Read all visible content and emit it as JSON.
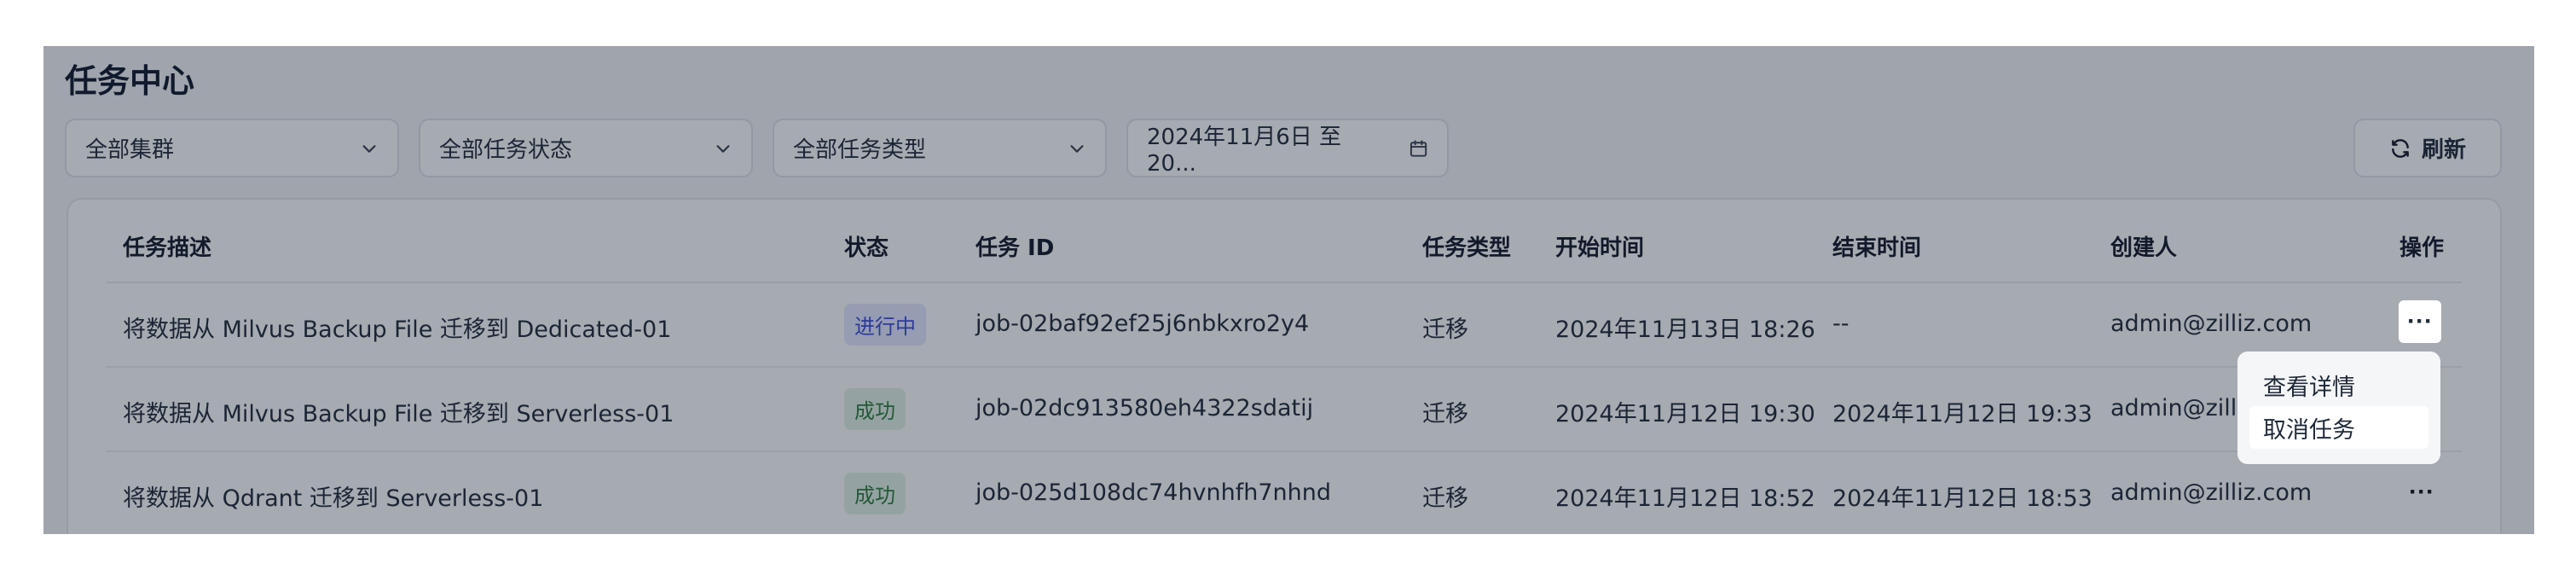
{
  "page": {
    "title": "任务中心"
  },
  "filters": {
    "cluster": "全部集群",
    "status": "全部任务状态",
    "type": "全部任务类型",
    "date_range": "2024年11月6日 至 20..."
  },
  "refresh_label": "刷新",
  "table": {
    "headers": {
      "desc": "任务描述",
      "status": "状态",
      "id": "任务 ID",
      "type": "任务类型",
      "start": "开始时间",
      "end": "结束时间",
      "creator": "创建人",
      "actions": "操作"
    },
    "rows": [
      {
        "desc": "将数据从 Milvus Backup File 迁移到 Dedicated-01",
        "status": "进行中",
        "id": "job-02baf92ef25j6nbkxro2y4",
        "type": "迁移",
        "start": "2024年11月13日 18:26",
        "end": "--",
        "creator": "admin@zilliz.com",
        "actions": "···"
      },
      {
        "desc": "将数据从 Milvus Backup File 迁移到 Serverless-01",
        "status": "成功",
        "id": "job-02dc913580eh4322sdatij",
        "type": "迁移",
        "start": "2024年11月12日 19:30",
        "end": "2024年11月12日 19:33",
        "creator": "admin@zilliz.com",
        "actions": "···"
      },
      {
        "desc": "将数据从 Qdrant 迁移到 Serverless-01",
        "status": "成功",
        "id": "job-025d108dc74hvnhfh7nhnd",
        "type": "迁移",
        "start": "2024年11月12日 18:52",
        "end": "2024年11月12日 18:53",
        "creator": "admin@zilliz.com",
        "actions": "···"
      }
    ]
  },
  "action_menu": {
    "items": [
      "查看详情",
      "取消任务"
    ],
    "highlighted": "取消任务"
  },
  "icons": [
    "chevron-down-icon",
    "calendar-icon",
    "refresh-icon",
    "more-icon"
  ],
  "colors": {
    "running_badge": "#3a4bd8",
    "success_badge": "#2e7d40",
    "overlay": "#151f33"
  }
}
